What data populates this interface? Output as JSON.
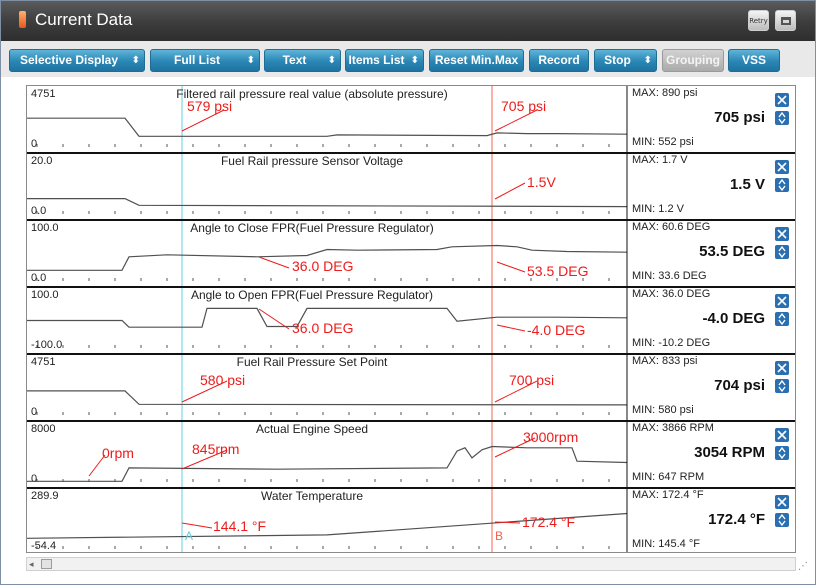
{
  "window": {
    "title": "Current Data",
    "retry_label": "Retry",
    "icons": [
      "retry-icon",
      "restore-icon"
    ]
  },
  "toolbar": {
    "buttons": [
      {
        "label": "Selective Display",
        "dropdown": true,
        "enabled": true
      },
      {
        "label": "Full List",
        "dropdown": true,
        "enabled": true
      },
      {
        "label": "Text",
        "dropdown": true,
        "enabled": true
      },
      {
        "label": "Items List",
        "dropdown": true,
        "enabled": true
      },
      {
        "label": "Reset Min.Max",
        "dropdown": false,
        "enabled": true
      },
      {
        "label": "Record",
        "dropdown": false,
        "enabled": true
      },
      {
        "label": "Stop",
        "dropdown": true,
        "enabled": true
      },
      {
        "label": "Grouping",
        "dropdown": false,
        "enabled": false
      },
      {
        "label": "VSS",
        "dropdown": false,
        "enabled": true
      }
    ]
  },
  "cursors": {
    "a": {
      "label": "A",
      "color": "#61d0e0"
    },
    "b": {
      "label": "B",
      "color": "#f06450"
    }
  },
  "colors": {
    "annotation": "#ee1b1b",
    "trace": "#505050",
    "close": "#2a6fb0"
  },
  "panels": [
    {
      "title": "Filtered rail pressure real value (absolute pressure)",
      "y_top": "4751",
      "y_bottom": "0",
      "max": "MAX:   890 psi",
      "current": "705 psi",
      "min": "MIN:   552 psi",
      "annotations": [
        "579 psi",
        "705 psi"
      ]
    },
    {
      "title": "Fuel Rail pressure Sensor Voltage",
      "y_top": "20.0",
      "y_bottom": "0.0",
      "max": "MAX:   1.7 V",
      "current": "1.5 V",
      "min": "MIN:   1.2 V",
      "annotations": [
        "1.5V"
      ]
    },
    {
      "title": "Angle to Close FPR(Fuel Pressure Regulator)",
      "y_top": "100.0",
      "y_bottom": "0.0",
      "max": "MAX:  60.6 DEG",
      "current": "53.5 DEG",
      "min": "MIN:  33.6 DEG",
      "annotations": [
        "36.0 DEG",
        "53.5 DEG"
      ]
    },
    {
      "title": "Angle to Open FPR(Fuel Pressure Regulator)",
      "y_top": "100.0",
      "y_bottom": "-100.0",
      "max": "MAX:   36.0 DEG",
      "current": "-4.0 DEG",
      "min": "MIN: -10.2 DEG",
      "annotations": [
        "36.0 DEG",
        "-4.0 DEG"
      ]
    },
    {
      "title": "Fuel Rail Pressure Set Point",
      "y_top": "4751",
      "y_bottom": "0",
      "max": "MAX:   833 psi",
      "current": "704 psi",
      "min": "MIN:   580 psi",
      "annotations": [
        "580 psi",
        "700 psi"
      ]
    },
    {
      "title": "Actual Engine Speed",
      "y_top": "8000",
      "y_bottom": "0",
      "max": "MAX:  3866 RPM",
      "current": "3054 RPM",
      "min": "MIN:   647 RPM",
      "annotations": [
        "0rpm",
        "845rpm",
        "3000rpm"
      ]
    },
    {
      "title": "Water Temperature",
      "y_top": "289.9",
      "y_bottom": "-54.4",
      "max": "MAX: 172.4 °F",
      "current": "172.4 °F",
      "min": "MIN: 145.4 °F",
      "annotations": [
        "144.1 °F",
        "172.4 °F"
      ]
    }
  ]
}
